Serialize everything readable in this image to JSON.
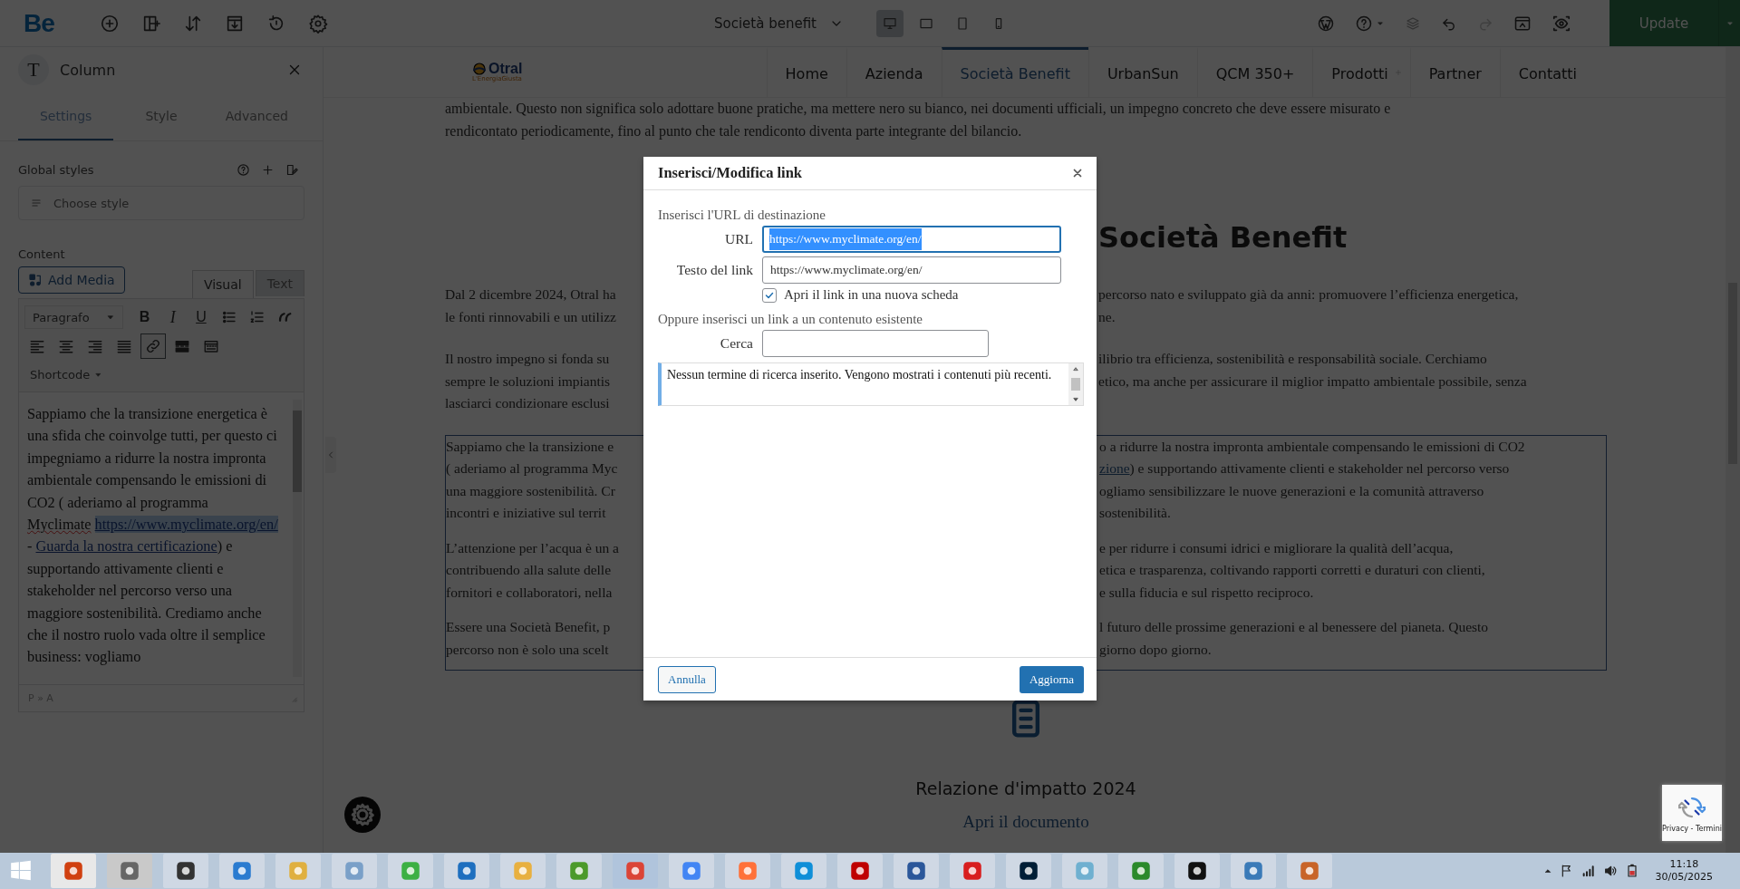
{
  "topbar": {
    "logo": "Be",
    "page_select": "Società benefit",
    "devices": [
      {
        "kind": "desktop",
        "selected": true
      },
      {
        "kind": "tablet-landscape",
        "selected": false
      },
      {
        "kind": "tablet",
        "selected": false
      },
      {
        "kind": "mobile",
        "selected": false
      }
    ],
    "redo": {
      "disabled": true
    },
    "update": "Update"
  },
  "panel": {
    "title": "Column",
    "avatar": "T",
    "tabs": [
      {
        "label": "Settings",
        "selected": true
      },
      {
        "label": "Style",
        "selected": false
      },
      {
        "label": "Advanced",
        "selected": false
      }
    ],
    "global_styles": "Global styles",
    "style_placeholder": "Choose style",
    "content_label": "Content",
    "add_media": "Add Media",
    "editor_tabs": [
      {
        "label": "Visual",
        "selected": true
      },
      {
        "label": "Text",
        "selected": false
      }
    ],
    "format": "Paragrafo",
    "toolbar_1": [
      {
        "kind": "bold",
        "label": "B",
        "active": false
      },
      {
        "kind": "italic",
        "label": "I",
        "active": false
      },
      {
        "kind": "underline",
        "label": "U",
        "active": false
      },
      {
        "kind": "bullets",
        "active": false
      },
      {
        "kind": "numbers",
        "active": false
      },
      {
        "kind": "quote",
        "active": false
      }
    ],
    "toolbar_2": [
      {
        "kind": "align-left",
        "active": false
      },
      {
        "kind": "align-center",
        "active": false
      },
      {
        "kind": "align-right",
        "active": false
      },
      {
        "kind": "justify",
        "active": false
      },
      {
        "kind": "link",
        "active": true
      },
      {
        "kind": "more",
        "active": false
      },
      {
        "kind": "toggle",
        "active": false
      }
    ],
    "shortcode": "Shortcode",
    "editor": [
      {
        "kind": "plain",
        "text": "Sappiamo che la transizione energetica è una sfida che coinvolge tutti, per questo ci impegniamo a ridurre la nostra impronta ambientale compensando le emissioni di CO2 ( aderiamo al programma "
      },
      {
        "kind": "misspelled",
        "text": "Myclimate"
      },
      {
        "kind": "link",
        "text": "https://www.myclimate.org/en/",
        "selected": true
      },
      {
        "kind": "plain",
        "text": " - "
      },
      {
        "kind": "link",
        "text": "Guarda la nostra certificazione",
        "selected": false
      },
      {
        "kind": "plain",
        "text": ")  e supportando attivamente clienti e stakeholder nel percorso verso una maggiore sostenibilità. Crediamo anche che il nostro ruolo vada oltre il semplice business: vogliamo"
      }
    ],
    "path": "P » A"
  },
  "nav": {
    "logo": "Otral",
    "tagline": "L'EnergiaGiusta",
    "items": [
      {
        "label": "Home",
        "selected": false,
        "submenu": false
      },
      {
        "label": "Azienda",
        "selected": false,
        "submenu": false
      },
      {
        "label": "Società Benefit",
        "selected": true,
        "submenu": false
      },
      {
        "label": "UrbanSun",
        "selected": false,
        "submenu": false
      },
      {
        "label": "QCM 350+",
        "selected": false,
        "submenu": false
      },
      {
        "label": "Prodotti",
        "selected": false,
        "submenu": true
      },
      {
        "label": "Partner",
        "selected": false,
        "submenu": false
      },
      {
        "label": "Contatti",
        "selected": false,
        "submenu": false
      }
    ]
  },
  "page": {
    "intro": [
      "ambientale. Questo non significa solo adottare buone pratiche, ma mettere nero su bianco, nei documenti ufficiali, un impegno concreto che deve essere misurato e",
      "rendicontato periodicamente, fino al punto che tale rendiconto diventa parte integrante del bilancio."
    ],
    "heading": "Società Benefit",
    "sections": [
      {
        "framed": false,
        "paragraphs": [
          [
            {
              "left": "Dal 2 dicembre 2024, Otral ha",
              "right": "percorso nato e sviluppato già da anni: promuovere l’efficienza energetica,"
            },
            {
              "left": "le fonti rinnovabili e un utilizz",
              "right": "ne."
            }
          ],
          [
            {
              "left": "Il nostro impegno si fonda su",
              "right": "ilibrio tra efficienza, sostenibilità e responsabilità sociale. Cerchiamo"
            },
            {
              "left": "sempre le soluzioni impiantis",
              "right": "etico, ma anche per assicurare il miglior impatto ambientale possibile, senza"
            },
            {
              "left": "lasciarci condizionare esclusi"
            }
          ]
        ]
      },
      {
        "framed": true,
        "paragraphs": [
          [
            {
              "left": "Sappiamo che la transizione e",
              "right": "o a ridurre la nostra impronta ambientale compensando le emissioni di CO2"
            },
            {
              "left": "( aderiamo al programma Myc",
              "right_link": "zione",
              "right": ")  e supportando attivamente clienti e stakeholder nel percorso verso"
            },
            {
              "left": "una maggiore sostenibilità. Cr",
              "right": "ogliamo sensibilizzare le nuove generazioni e la comunità attraverso"
            },
            {
              "left": "incontri e iniziative sul territ",
              "right": "sostenibilità."
            }
          ],
          [
            {
              "left": "L’attenzione per l’acqua è un a",
              "right": "e per ridurre i consumi idrici e migliorare la qualità dell’acqua,"
            },
            {
              "left": "contribuendo alla salute delle",
              "right": "etica e trasparenza, coltivando rapporti corretti e duraturi con clienti,"
            },
            {
              "left": "fornitori e collaboratori, nella",
              "right": "e sulla fiducia e sul rispetto reciproco."
            }
          ],
          [
            {
              "left": "Essere una Società Benefit, p",
              "right": "l futuro delle prossime generazioni e al benessere del pianeta. Questo"
            },
            {
              "left": "percorso non è solo una scelt",
              "right": "giorno dopo giorno."
            }
          ]
        ]
      }
    ],
    "document": {
      "title": "Relazione d'impatto 2024",
      "link": "Apri il documento"
    }
  },
  "recaptcha": "Privacy - Termini",
  "dialog": {
    "title": "Inserisci/Modifica link",
    "url_section": "Inserisci l'URL di destinazione",
    "url_label": "URL",
    "url_value": "https://www.myclimate.org/en/",
    "text_label": "Testo del link",
    "text_value": "https://www.myclimate.org/en/",
    "new_tab": {
      "label": "Apri il link in una nuova scheda",
      "checked": true
    },
    "existing_section": "Oppure inserisci un link a un contenuto esistente",
    "search_label": "Cerca",
    "notice": "Nessun termine di ricerca inserito. Vengono mostrati i contenuti più recenti.",
    "cancel": "Annulla",
    "submit": "Aggiorna"
  },
  "taskbar": {
    "time": "11:18",
    "date": "30/05/2025"
  }
}
